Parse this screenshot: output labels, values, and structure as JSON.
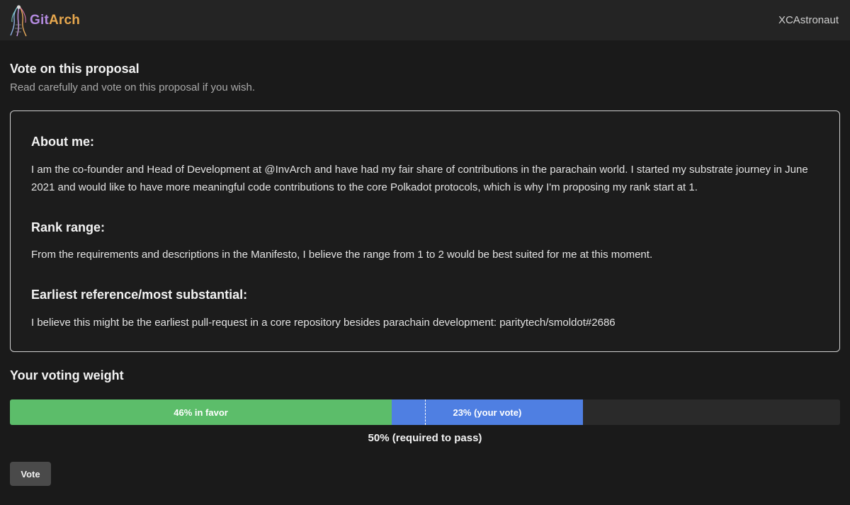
{
  "header": {
    "logo_text_part1": "Git",
    "logo_text_part2": "Arch",
    "logo_icon": "gitarch-logo-icon",
    "username": "XCAstronaut"
  },
  "page": {
    "title": "Vote on this proposal",
    "subtitle": "Read carefully and vote on this proposal if you wish."
  },
  "proposal": {
    "sections": [
      {
        "heading": "About me:",
        "text": "I am the co-founder and Head of Development at @InvArch and have had my fair share of contributions in the parachain world. I started my substrate journey in June 2021 and would like to have more meaningful code contributions to the core Polkadot protocols, which is why I'm proposing my rank start at 1."
      },
      {
        "heading": "Rank range:",
        "text": "From the requirements and descriptions in the Manifesto, I believe the range from 1 to 2 would be best suited for me at this moment."
      },
      {
        "heading": "Earliest reference/most substantial:",
        "text": "I believe this might be the earliest pull-request in a core repository besides parachain development: paritytech/smoldot#2686"
      }
    ]
  },
  "voting": {
    "title": "Your voting weight",
    "in_favor_percent": 46,
    "in_favor_label": "46% in favor",
    "your_vote_percent": 23,
    "your_vote_label": "23% (your vote)",
    "required_percent": 50,
    "required_label": "50% (required to pass)",
    "colors": {
      "in_favor": "#5cbd6a",
      "your_vote": "#4f7fe2",
      "track": "#2a2a2a"
    },
    "vote_button_label": "Vote"
  }
}
